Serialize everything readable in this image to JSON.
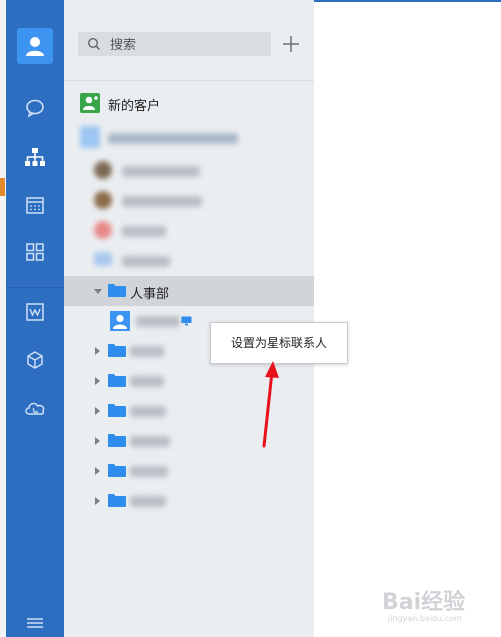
{
  "search": {
    "placeholder": "搜索"
  },
  "panel": {
    "new_customers_label": "新的客户",
    "dept_label": "人事部"
  },
  "tooltip": {
    "label": "设置为星标联系人"
  },
  "watermark": {
    "brand": "Bai经验",
    "url": "jingyan.baidu.com"
  },
  "colors": {
    "rail": "#2d6ec0",
    "avatar_tile": "#3d93f0",
    "panel": "#ebeef1",
    "selected_row": "#d1d5da",
    "folder": "#2f8ded",
    "new_customer_icon": "#3aa64b",
    "arrow": "#e8121b"
  },
  "icons": {
    "rail": [
      "user-avatar-icon",
      "chat-bubble-icon",
      "org-chart-icon",
      "calendar-icon",
      "apps-grid-icon",
      "workbench-icon",
      "cube-icon",
      "cloud-phone-icon",
      "menu-icon"
    ],
    "panel": [
      "search-icon",
      "plus-icon",
      "new-customer-icon",
      "folder-icon",
      "computer-icon"
    ]
  }
}
